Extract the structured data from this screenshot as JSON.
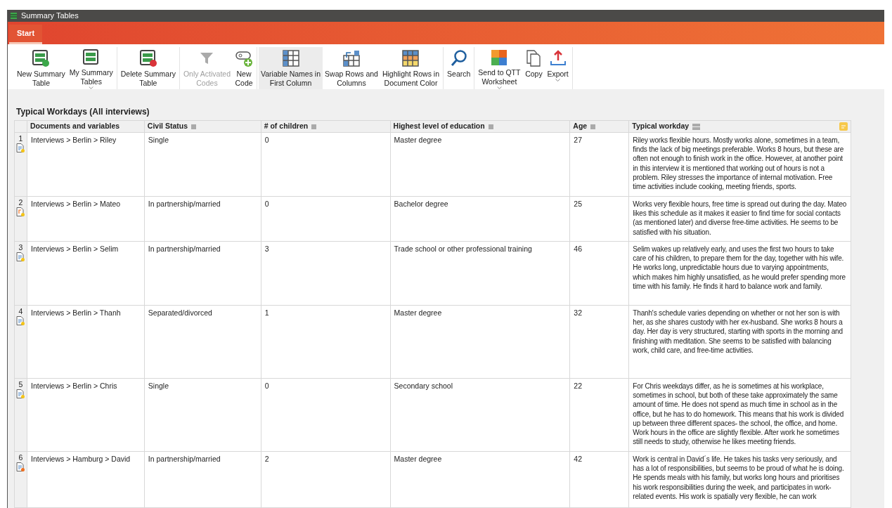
{
  "window": {
    "title": "Summary Tables"
  },
  "tabs": [
    {
      "label": "Start",
      "selected": true
    }
  ],
  "ribbon": [
    [
      {
        "kind": "new-table",
        "label": "New Summary\nTable",
        "disabled": false,
        "selected": false,
        "dropdown": false
      },
      {
        "kind": "tables",
        "label": "My Summary\nTables",
        "disabled": false,
        "selected": false,
        "dropdown": true
      }
    ],
    [
      {
        "kind": "delete-table",
        "label": "Delete Summary\nTable",
        "disabled": false,
        "selected": false,
        "dropdown": false
      }
    ],
    [
      {
        "kind": "filter",
        "label": "Only Activated\nCodes",
        "disabled": true,
        "selected": false,
        "dropdown": false
      },
      {
        "kind": "new-code",
        "label": "New\nCode",
        "disabled": false,
        "selected": false,
        "dropdown": false
      }
    ],
    [
      {
        "kind": "grid",
        "label": "Variable Names in\nFirst Column",
        "disabled": false,
        "selected": true,
        "dropdown": false
      },
      {
        "kind": "swap",
        "label": "Swap Rows and\nColumns",
        "disabled": false,
        "selected": false,
        "dropdown": false
      },
      {
        "kind": "color-grid",
        "label": "Highlight Rows in\nDocument Color",
        "disabled": false,
        "selected": false,
        "dropdown": false
      }
    ],
    [
      {
        "kind": "search",
        "label": "Search",
        "disabled": false,
        "selected": false,
        "dropdown": false
      }
    ],
    [
      {
        "kind": "puzzle",
        "label": "Send to QTT\nWorksheet",
        "disabled": false,
        "selected": false,
        "dropdown": true
      },
      {
        "kind": "copy",
        "label": "Copy",
        "disabled": false,
        "selected": false,
        "dropdown": false
      },
      {
        "kind": "export",
        "label": "Export",
        "disabled": false,
        "selected": false,
        "dropdown": true
      }
    ]
  ],
  "table_title": "Typical Workdays (All interviews)",
  "table": {
    "columns": [
      {
        "label": "Documents and variables",
        "kind": "plain"
      },
      {
        "label": "Civil Status",
        "kind": "variable"
      },
      {
        "label": "# of children",
        "kind": "variable"
      },
      {
        "label": "Highest level of education",
        "kind": "variable"
      },
      {
        "label": "Age",
        "kind": "variable"
      },
      {
        "label": "Typical workday",
        "kind": "summary"
      }
    ],
    "rows": [
      {
        "number": "1",
        "kind": "text",
        "color": "#f5c518",
        "cells": [
          "Interviews > Berlin > Riley",
          "Single",
          "0",
          "Master degree",
          "27",
          "Riley works flexible hours. Mostly works alone, sometimes in a team, finds the lack of big meetings preferable. Works 8 hours, but these are often not enough to finish work in the office. However, at another point in this interview it is mentioned that working out of hours is not a problem. Riley stresses the importance of internal motivation. Free time activities include cooking, meeting friends, sports."
        ]
      },
      {
        "number": "2",
        "kind": "audio",
        "color": "#f5c518",
        "cells": [
          "Interviews > Berlin > Mateo",
          "In partnership/married",
          "0",
          "Bachelor degree",
          "25",
          "Works very flexible hours, free time is spread out during the day. Mateo likes this schedule as it makes it easier to find time for social contacts (as mentioned later) and diverse free-time activities. He seems to be satisfied with his situation."
        ]
      },
      {
        "number": "3",
        "kind": "text",
        "color": "#f5c518",
        "cells": [
          "Interviews > Berlin > Selim",
          "In partnership/married",
          "3",
          "Trade school or other professional training",
          "46",
          "Selim wakes up relatively early, and uses the first two hours to take care of his children, to prepare them for the day, together with his wife. He works long, unpredictable hours due to varying appointments, which makes him highly unsatisfied, as he would prefer spending more time with his family. He finds it hard to balance work and family."
        ]
      },
      {
        "number": "4",
        "kind": "text",
        "color": "#f5c518",
        "cells": [
          "Interviews > Berlin > Thanh",
          "Separated/divorced",
          "1",
          "Master degree",
          "32",
          "Thanh's schedule varies depending on whether or not her son is with her, as she shares custody with her ex-husband. She works 8 hours a day. Her day is very structured, starting with sports in the morning and finishing with meditation. She seems to be satisfied with balancing work, child care, and free-time activities."
        ]
      },
      {
        "number": "5",
        "kind": "text",
        "color": "#f5c518",
        "cells": [
          "Interviews > Berlin > Chris",
          "Single",
          "0",
          "Secondary school",
          "22",
          "For Chris weekdays differ, as he is sometimes at his workplace, sometimes in school, but both of these take approximately the same amount of time. He does not spend as much time in school as in the office, but he has to do homework. This means that his work is divided up between three different spaces- the school, the office, and home. Work hours in the office are slightly flexible. After work he sometimes still needs to study, otherwise he likes meeting friends."
        ]
      },
      {
        "number": "6",
        "kind": "text",
        "color": "#f07020",
        "cells": [
          "Interviews > Hamburg > David",
          "In partnership/married",
          "2",
          "Master degree",
          "42",
          "Work is central in David´s life. He takes his tasks very seriously, and has a lot of responsibilities, but seems to be proud of what he is doing. He spends meals with his family, but works long hours and prioritises his work responsibilities during the week, and participates in work-related events. His work is spatially very flexible, he can work"
        ]
      }
    ]
  }
}
